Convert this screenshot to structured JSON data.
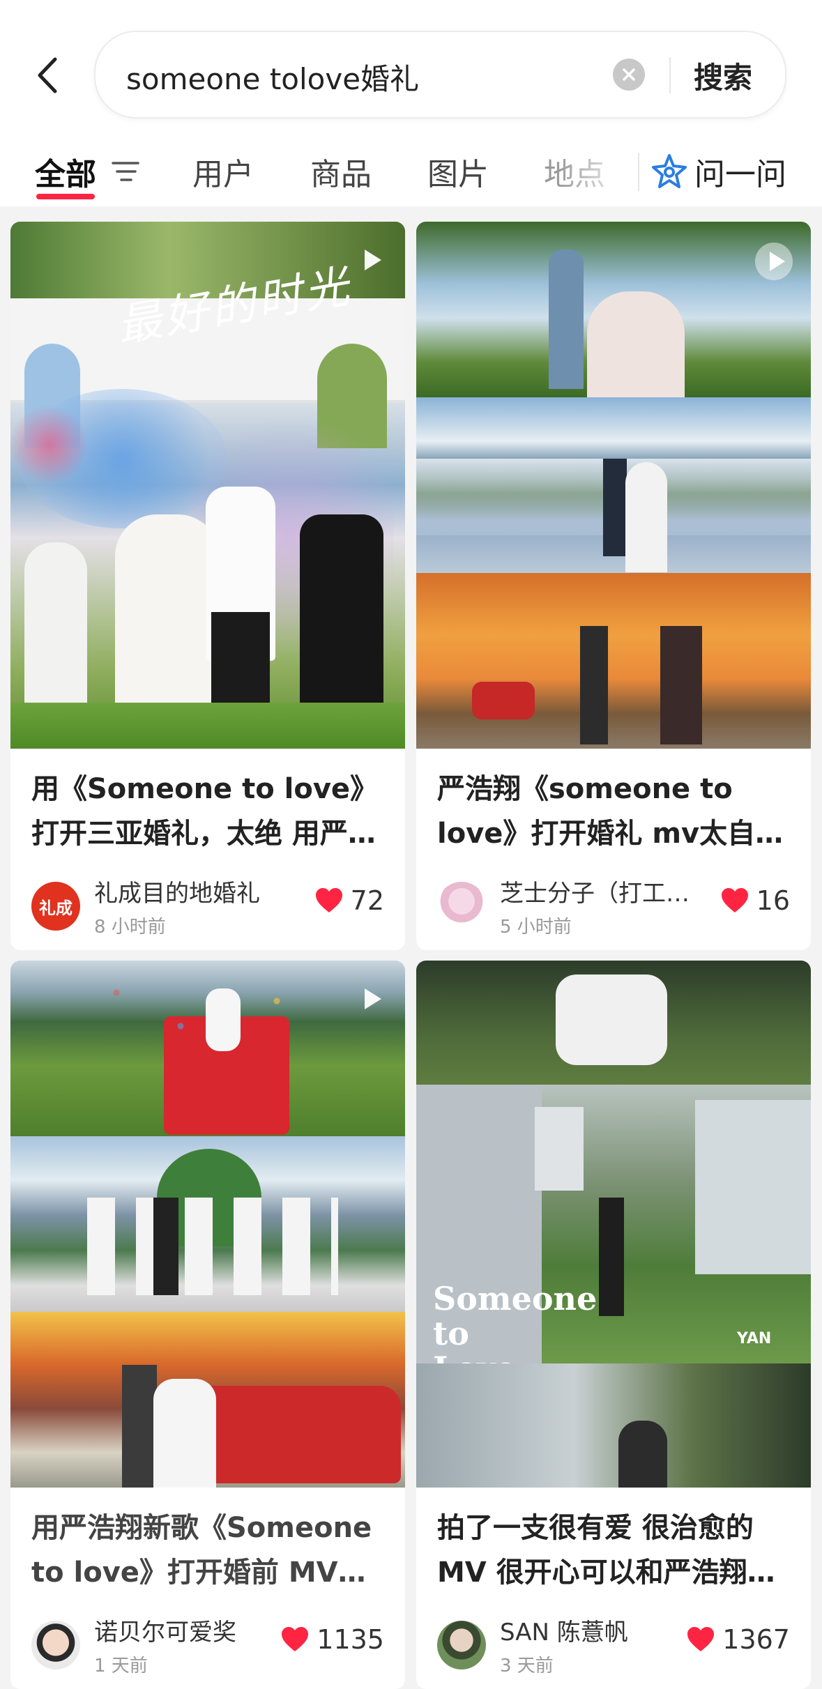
{
  "search": {
    "query": "someone tolove婚礼",
    "button": "搜索"
  },
  "tabs": [
    {
      "label": "全部"
    },
    {
      "label": "用户"
    },
    {
      "label": "商品"
    },
    {
      "label": "图片"
    },
    {
      "label": "地点"
    }
  ],
  "ask": {
    "label": "问一问"
  },
  "colors": {
    "accent": "#ff2442",
    "ask_icon": "#2a7de1"
  },
  "cards": [
    {
      "title": "用《Someone to love》打开三亚婚礼，太绝 用严…",
      "image_text": "最好的时光",
      "author": "礼成目的地婚礼",
      "avatar_text": "礼成",
      "time": "8 小时前",
      "likes": "72",
      "video": true
    },
    {
      "title": "严浩翔《someone to love》打开婚礼 mv太自…",
      "author": "芝士分子（打工…",
      "time": "5 小时前",
      "likes": "16",
      "video": true
    },
    {
      "title": "用严浩翔新歌《Someone to love》打开婚前 MV…",
      "author": "诺贝尔可爱奖",
      "time": "1 天前",
      "likes": "1135",
      "video": true
    },
    {
      "title": "拍了一支很有爱 很治愈的 MV 很开心可以和严浩翔…",
      "image_text": "Someone to Love",
      "image_mark": "YAN",
      "author": "SAN 陈薏帆",
      "time": "3 天前",
      "likes": "1367",
      "video": false
    }
  ]
}
